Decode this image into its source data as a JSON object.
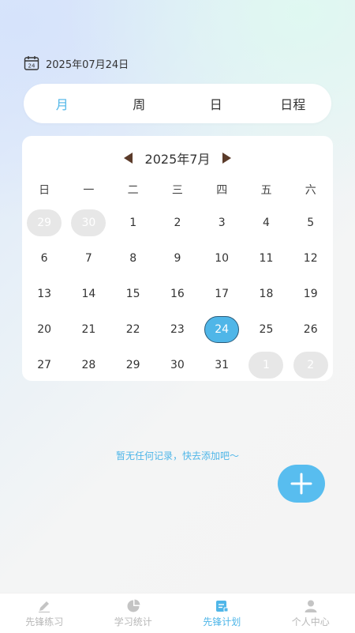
{
  "header": {
    "date": "2025年07月24日",
    "calendar_icon_day": "24"
  },
  "view_tabs": [
    {
      "label": "月",
      "active": true
    },
    {
      "label": "周",
      "active": false
    },
    {
      "label": "日",
      "active": false
    },
    {
      "label": "日程",
      "active": false
    }
  ],
  "calendar": {
    "month_label": "2025年7月",
    "weekdays": [
      "日",
      "一",
      "二",
      "三",
      "四",
      "五",
      "六"
    ],
    "days": [
      {
        "label": "29",
        "state": "other"
      },
      {
        "label": "30",
        "state": "other"
      },
      {
        "label": "1",
        "state": "current"
      },
      {
        "label": "2",
        "state": "current"
      },
      {
        "label": "3",
        "state": "current"
      },
      {
        "label": "4",
        "state": "current"
      },
      {
        "label": "5",
        "state": "current"
      },
      {
        "label": "6",
        "state": "current"
      },
      {
        "label": "7",
        "state": "current"
      },
      {
        "label": "8",
        "state": "current"
      },
      {
        "label": "9",
        "state": "current"
      },
      {
        "label": "10",
        "state": "current"
      },
      {
        "label": "11",
        "state": "current"
      },
      {
        "label": "12",
        "state": "current"
      },
      {
        "label": "13",
        "state": "current"
      },
      {
        "label": "14",
        "state": "current"
      },
      {
        "label": "15",
        "state": "current"
      },
      {
        "label": "16",
        "state": "current"
      },
      {
        "label": "17",
        "state": "current"
      },
      {
        "label": "18",
        "state": "current"
      },
      {
        "label": "19",
        "state": "current"
      },
      {
        "label": "20",
        "state": "current"
      },
      {
        "label": "21",
        "state": "current"
      },
      {
        "label": "22",
        "state": "current"
      },
      {
        "label": "23",
        "state": "current"
      },
      {
        "label": "24",
        "state": "today"
      },
      {
        "label": "25",
        "state": "current"
      },
      {
        "label": "26",
        "state": "current"
      },
      {
        "label": "27",
        "state": "current"
      },
      {
        "label": "28",
        "state": "current"
      },
      {
        "label": "29",
        "state": "current"
      },
      {
        "label": "30",
        "state": "current"
      },
      {
        "label": "31",
        "state": "current"
      },
      {
        "label": "1",
        "state": "other"
      },
      {
        "label": "2",
        "state": "other"
      }
    ]
  },
  "empty_state": "暂无任何记录，快去添加吧～",
  "fab": {
    "icon": "plus-icon"
  },
  "bottom_nav": [
    {
      "label": "先锋练习",
      "icon": "pen-icon",
      "active": false
    },
    {
      "label": "学习统计",
      "icon": "pie-chart-icon",
      "active": false
    },
    {
      "label": "先锋计划",
      "icon": "plan-icon",
      "active": true
    },
    {
      "label": "个人中心",
      "icon": "person-icon",
      "active": false
    }
  ],
  "colors": {
    "accent": "#4fb6e8",
    "fab": "#58bdef",
    "arrow": "#5b3b2a",
    "inactive_nav": "#b8b8b8",
    "other_month_bg": "#e7e7e7"
  }
}
